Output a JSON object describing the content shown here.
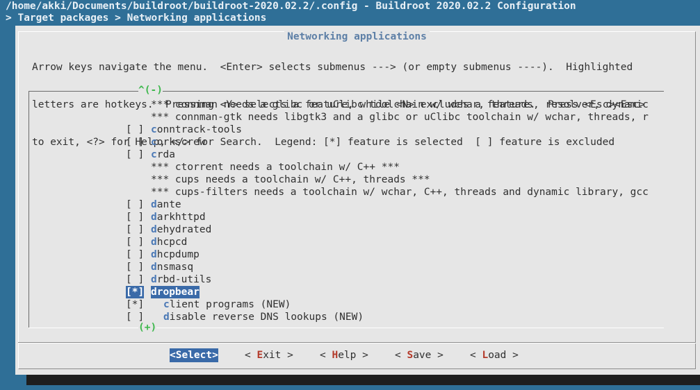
{
  "window": {
    "title": "/home/akki/Documents/buildroot/buildroot-2020.02.2/.config - Buildroot 2020.02.2 Configuration",
    "breadcrumb": "> Target packages > Networking applications"
  },
  "dialog": {
    "title": "Networking applications",
    "help_lines": [
      "Arrow keys navigate the menu.  <Enter> selects submenus ---> (or empty submenus ----).  Highlighted",
      "letters are hotkeys.  Pressing <Y> selects a feature, while <N> excludes a feature.  Press <Esc><Esc>",
      "to exit, <?> for Help, </> for Search.  Legend: [*] feature is selected  [ ] feature is excluded"
    ]
  },
  "menu": {
    "scroll_up": "^(-)",
    "scroll_down": "(+)",
    "items": [
      {
        "mark": "",
        "hotkey": "",
        "rest": "*** connman needs a glibc or uClibc toolchain w/ wchar, threads, resolver, dynamic",
        "child": false
      },
      {
        "mark": "",
        "hotkey": "",
        "rest": "*** connman-gtk needs libgtk3 and a glibc or uClibc toolchain w/ wchar, threads, r",
        "child": false
      },
      {
        "mark": "[ ]",
        "hotkey": "c",
        "rest": "onntrack-tools",
        "child": false
      },
      {
        "mark": "[ ]",
        "hotkey": "c",
        "rest": "orkscrew",
        "child": false
      },
      {
        "mark": "[ ]",
        "hotkey": "c",
        "rest": "rda",
        "child": false
      },
      {
        "mark": "",
        "hotkey": "",
        "rest": "*** ctorrent needs a toolchain w/ C++ ***",
        "child": false
      },
      {
        "mark": "",
        "hotkey": "",
        "rest": "*** cups needs a toolchain w/ C++, threads ***",
        "child": false
      },
      {
        "mark": "",
        "hotkey": "",
        "rest": "*** cups-filters needs a toolchain w/ wchar, C++, threads and dynamic library, gcc",
        "child": false
      },
      {
        "mark": "[ ]",
        "hotkey": "d",
        "rest": "ante",
        "child": false
      },
      {
        "mark": "[ ]",
        "hotkey": "d",
        "rest": "arkhttpd",
        "child": false
      },
      {
        "mark": "[ ]",
        "hotkey": "d",
        "rest": "ehydrated",
        "child": false
      },
      {
        "mark": "[ ]",
        "hotkey": "d",
        "rest": "hcpcd",
        "child": false
      },
      {
        "mark": "[ ]",
        "hotkey": "d",
        "rest": "hcpdump",
        "child": false
      },
      {
        "mark": "[ ]",
        "hotkey": "d",
        "rest": "nsmasq",
        "child": false
      },
      {
        "mark": "[ ]",
        "hotkey": "d",
        "rest": "rbd-utils",
        "child": false
      },
      {
        "mark": "[*]",
        "hotkey": "d",
        "rest": "ropbear",
        "child": false,
        "selected": true
      },
      {
        "mark": "[*]",
        "hotkey": "c",
        "rest": "lient programs (NEW)",
        "child": true
      },
      {
        "mark": "[ ]",
        "hotkey": "d",
        "rest": "isable reverse DNS lookups (NEW)",
        "child": true
      }
    ]
  },
  "buttons": [
    {
      "pre": "<",
      "key": "S",
      "post": "elect>",
      "active": true
    },
    {
      "pre": "< ",
      "key": "E",
      "post": "xit >",
      "active": false
    },
    {
      "pre": "< ",
      "key": "H",
      "post": "elp >",
      "active": false
    },
    {
      "pre": "< ",
      "key": "S",
      "post": "ave >",
      "active": false
    },
    {
      "pre": "< ",
      "key": "L",
      "post": "oad >",
      "active": false
    }
  ],
  "colors": {
    "background": "#2f6f97",
    "dialog": "#e6e6e6",
    "highlight": "#3a6aa8",
    "hotkey": "#4a78b5",
    "button_hotkey": "#b33a2a",
    "scroll_indicator": "#3fb84e"
  }
}
